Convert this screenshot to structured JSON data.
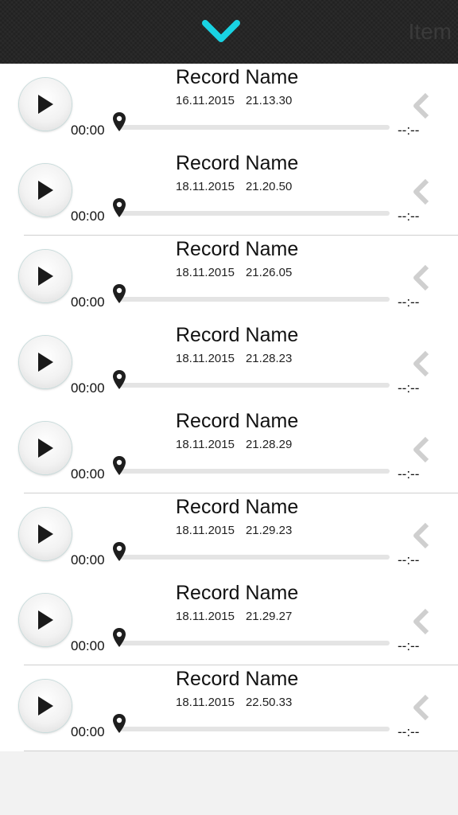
{
  "header": {
    "collapse_icon": "chevron-down-icon",
    "accent_color": "#19d3e3",
    "right_label": "Item"
  },
  "records": [
    {
      "name": "Record Name",
      "date": "16.11.2015",
      "time": "21.13.30",
      "elapsed": "00:00",
      "duration": "--:--"
    },
    {
      "name": "Record Name",
      "date": "18.11.2015",
      "time": "21.20.50",
      "elapsed": "00:00",
      "duration": "--:--"
    },
    {
      "name": "Record Name",
      "date": "18.11.2015",
      "time": "21.26.05",
      "elapsed": "00:00",
      "duration": "--:--"
    },
    {
      "name": "Record Name",
      "date": "18.11.2015",
      "time": "21.28.23",
      "elapsed": "00:00",
      "duration": "--:--"
    },
    {
      "name": "Record Name",
      "date": "18.11.2015",
      "time": "21.28.29",
      "elapsed": "00:00",
      "duration": "--:--"
    },
    {
      "name": "Record Name",
      "date": "18.11.2015",
      "time": "21.29.23",
      "elapsed": "00:00",
      "duration": "--:--"
    },
    {
      "name": "Record Name",
      "date": "18.11.2015",
      "time": "21.29.27",
      "elapsed": "00:00",
      "duration": "--:--"
    },
    {
      "name": "Record Name",
      "date": "18.11.2015",
      "time": "22.50.33",
      "elapsed": "00:00",
      "duration": "--:--"
    }
  ],
  "row_icons": {
    "play": "play-icon",
    "position_marker": "map-pin-icon",
    "swipe_hint": "chevron-left-icon"
  }
}
